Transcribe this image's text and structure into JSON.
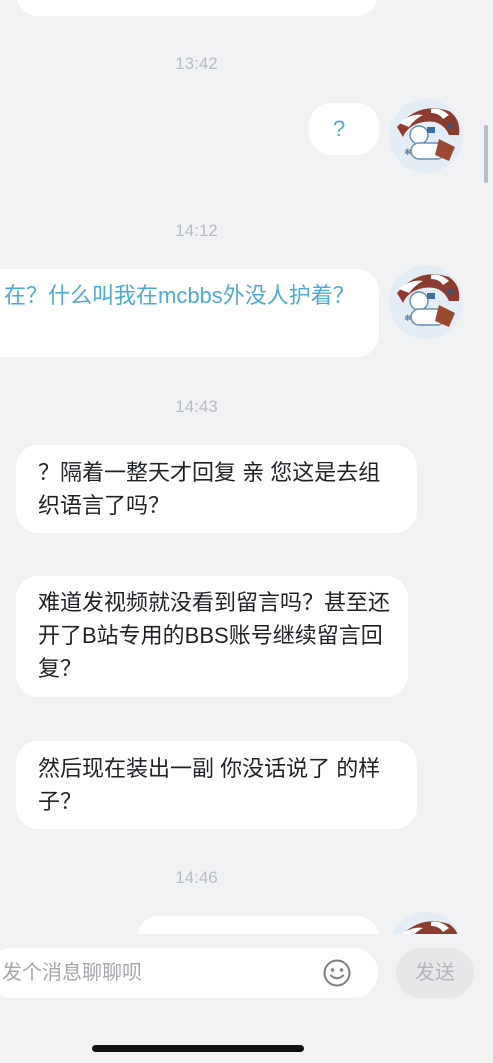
{
  "chat": {
    "timestamps": [
      "13:42",
      "14:12",
      "14:43",
      "14:46"
    ],
    "messages": [
      {
        "side": "out",
        "text": "?"
      },
      {
        "side": "out",
        "text": "在？什么叫我在mcbbs外没人护着？"
      },
      {
        "side": "in",
        "text": "？隔着一整天才回复 亲 您这是去组织语言了吗？"
      },
      {
        "side": "in",
        "text": "难道发视频就没看到留言吗？甚至还开了B站专用的BBS账号继续留言回复？"
      },
      {
        "side": "in",
        "text": "然后现在装出一副 你没话说了 的样子？"
      }
    ]
  },
  "composer": {
    "placeholder": "发个消息聊聊呗",
    "emoji_icon": "smiley-face-icon",
    "send_label": "发送"
  },
  "colors": {
    "background": "#f1f2f4",
    "bubble": "#ffffff",
    "outgoing_text": "#4da9d6",
    "incoming_text": "#1f2327",
    "timestamp": "#b8bcc2"
  }
}
